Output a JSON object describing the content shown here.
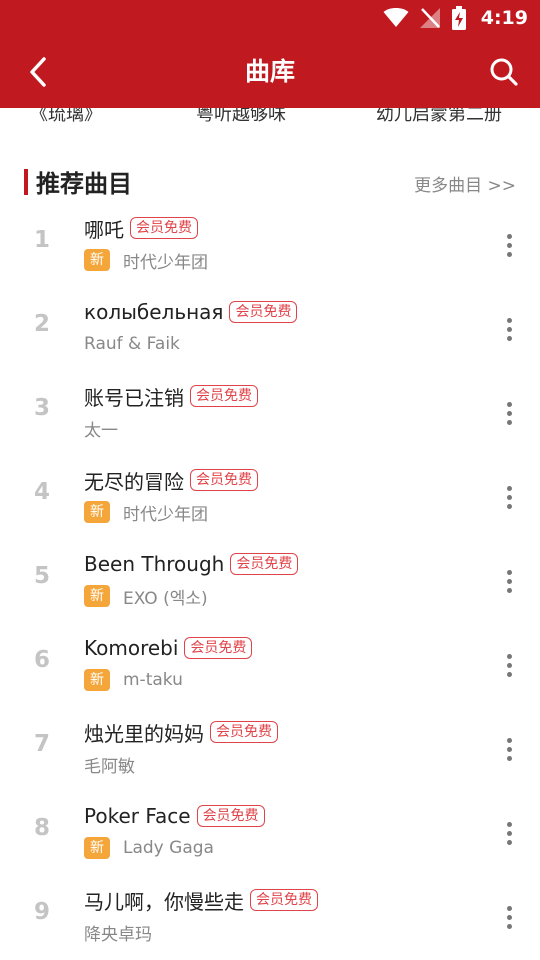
{
  "status_bar": {
    "time": "4:19"
  },
  "app_bar": {
    "title": "曲库"
  },
  "categories": [
    "《琉璃》",
    "粤听越够味",
    "幼儿启蒙第二册"
  ],
  "section": {
    "title": "推荐曲目",
    "more_link": "更多曲目 >>"
  },
  "songs": [
    {
      "rank": "1",
      "title": "哪吒",
      "vip_badge": "会员免费",
      "is_new": true,
      "new_label": "新",
      "artist": "时代少年团"
    },
    {
      "rank": "2",
      "title": "колыбельная",
      "vip_badge": "会员免费",
      "is_new": false,
      "new_label": "",
      "artist": "Rauf & Faik"
    },
    {
      "rank": "3",
      "title": "账号已注销",
      "vip_badge": "会员免费",
      "is_new": false,
      "new_label": "",
      "artist": "太一"
    },
    {
      "rank": "4",
      "title": "无尽的冒险",
      "vip_badge": "会员免费",
      "is_new": true,
      "new_label": "新",
      "artist": "时代少年团"
    },
    {
      "rank": "5",
      "title": "Been Through",
      "vip_badge": "会员免费",
      "is_new": true,
      "new_label": "新",
      "artist": "EXO (엑소)"
    },
    {
      "rank": "6",
      "title": "Komorebi",
      "vip_badge": "会员免费",
      "is_new": true,
      "new_label": "新",
      "artist": "m-taku"
    },
    {
      "rank": "7",
      "title": "烛光里的妈妈",
      "vip_badge": "会员免费",
      "is_new": false,
      "new_label": "",
      "artist": "毛阿敏"
    },
    {
      "rank": "8",
      "title": "Poker Face",
      "vip_badge": "会员免费",
      "is_new": true,
      "new_label": "新",
      "artist": "Lady Gaga"
    },
    {
      "rank": "9",
      "title": "马儿啊，你慢些走",
      "vip_badge": "会员免费",
      "is_new": false,
      "new_label": "",
      "artist": "降央卓玛"
    }
  ],
  "colors": {
    "primary": "#c0191f",
    "vip": "#e0444a",
    "new_badge": "#f4a63a",
    "rank": "#c4c4c4"
  },
  "icons": {
    "back": "chevron-left-icon",
    "search": "search-icon",
    "more": "more-vertical-icon",
    "wifi": "wifi-icon",
    "signal": "no-signal-icon",
    "battery": "battery-charging-icon"
  }
}
